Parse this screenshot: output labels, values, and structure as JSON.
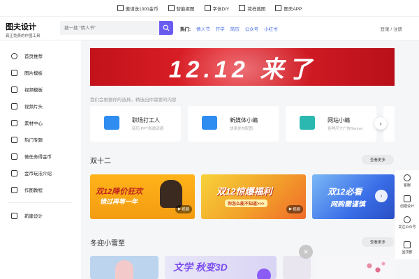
{
  "topbar": {
    "items": [
      {
        "label": "邀请送1000金币",
        "icon": "gift-icon"
      },
      {
        "label": "智能抠图",
        "icon": "cutout-icon"
      },
      {
        "label": "字体DIY",
        "icon": "font-icon"
      },
      {
        "label": "花样裁图",
        "icon": "crop-icon"
      },
      {
        "label": "图夫APP",
        "icon": "app-icon"
      }
    ]
  },
  "header": {
    "logo_title": "图夫设计",
    "logo_subtitle": "真正免费的作图工具",
    "search_placeholder": "搜一搜 \"情人节\"",
    "hot_label": "热门:",
    "hot_tags": [
      "情人节",
      "开学",
      "简历",
      "公众号",
      "小红书"
    ],
    "auth": "登录 / 注册"
  },
  "sidebar": {
    "items": [
      {
        "label": "首页推荐",
        "icon": "compass-icon"
      },
      {
        "label": "图片模板",
        "icon": "image-template-icon"
      },
      {
        "label": "视频模板",
        "icon": "video-template-icon"
      },
      {
        "label": "视频片头",
        "icon": "video-intro-icon"
      },
      {
        "label": "素材中心",
        "icon": "material-icon"
      },
      {
        "label": "热门专题",
        "icon": "topic-icon"
      },
      {
        "label": "做任务得金币",
        "icon": "task-icon"
      },
      {
        "label": "金币玩法介绍",
        "icon": "cube-icon"
      },
      {
        "label": "作图教程",
        "icon": "tutorial-icon"
      }
    ],
    "new_design": "新建设计"
  },
  "banner": {
    "text": "12.12 来了"
  },
  "hint": "我们会根据你的选择，精选出你需要的内容",
  "categories": [
    {
      "title": "职场打工人",
      "subtitle": "简历,PPT和邀请函",
      "color": "#2f8cf0"
    },
    {
      "title": "新媒体小编",
      "subtitle": "快速发布配图",
      "color": "#2f8cf0"
    },
    {
      "title": "网站小编",
      "subtitle": "各种尺寸广告Banner",
      "color": "#2bb8b0"
    }
  ],
  "sections": [
    {
      "title": "双十二",
      "more": "查看更多"
    },
    {
      "title": "冬迎小雪至",
      "more": "查看更多"
    }
  ],
  "cards1": [
    {
      "text1": "双12降价狂欢",
      "text2": "错过再等一年",
      "badge": "视频"
    },
    {
      "text1": "双12惊爆福利",
      "text2": "你怎么能不知道>>>",
      "badge": "视频"
    },
    {
      "text1": "双12必看",
      "text2": "网购需谨慎",
      "badge": ""
    }
  ],
  "cards2": [
    {
      "text1": "文学 秋变3D"
    }
  ],
  "rightbar": {
    "items": [
      {
        "label": "客服",
        "icon": "headset-icon"
      },
      {
        "label": "创建设计",
        "icon": "create-icon"
      },
      {
        "label": "关注公众号",
        "icon": "wechat-icon"
      },
      {
        "label": "回顶部",
        "icon": "back-top-icon"
      }
    ]
  },
  "colors": {
    "accent": "#6b5cf0",
    "link": "#4a6ee0",
    "banner": "#d81e27"
  }
}
